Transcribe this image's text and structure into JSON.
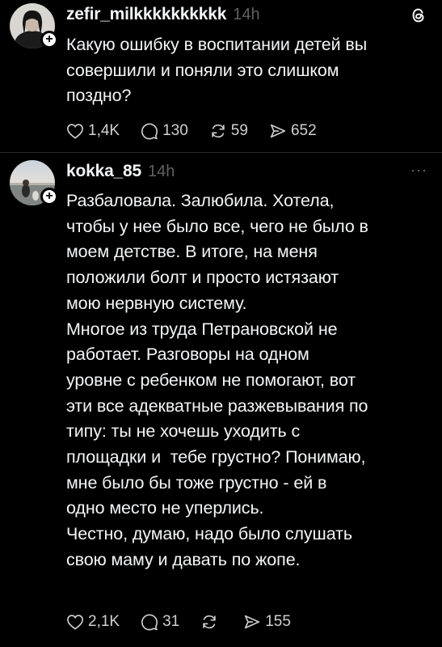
{
  "posts": [
    {
      "username": "zefir_milkkkkkkkkkk",
      "time": "14h",
      "text": "Какую ошибку в воспитании детей вы\nсовершили и поняли это слишком\nпоздно?",
      "likes": "1,4K",
      "replies": "130",
      "reposts": "59",
      "shares": "652",
      "header_icon": "threads-logo-icon",
      "avatar_icon": "profile-photo-icon"
    },
    {
      "username": "kokka_85",
      "time": "14h",
      "text": "Разбаловала. Залюбила. Хотела,\nчтобы у нее было все, чего не было в\nмоем детстве. В итоге, на меня\nположили болт и просто истязают\nмою нервную систему.\nМногое из труда Петрановской не\nработает. Разговоры на одном\nуровне с ребенком не помогают, вот\nэти все адекватные разжевывания по\nтипу: ты не хочешь уходить с\nплощадки и  тебе грустно? Понимаю,\nмне было бы тоже грустно - ей в\nодно место не уперлись.\nЧестно, думаю, надо было слушать\nсвою маму и давать по жопе.",
      "likes": "2,1K",
      "replies": "31",
      "shares": "155",
      "more_label": "···",
      "avatar_icon": "profile-photo-icon"
    }
  ],
  "colors": {
    "background": "#000000",
    "text": "#f3f5f7",
    "secondary": "#616161",
    "divider": "#2a2a2a"
  }
}
